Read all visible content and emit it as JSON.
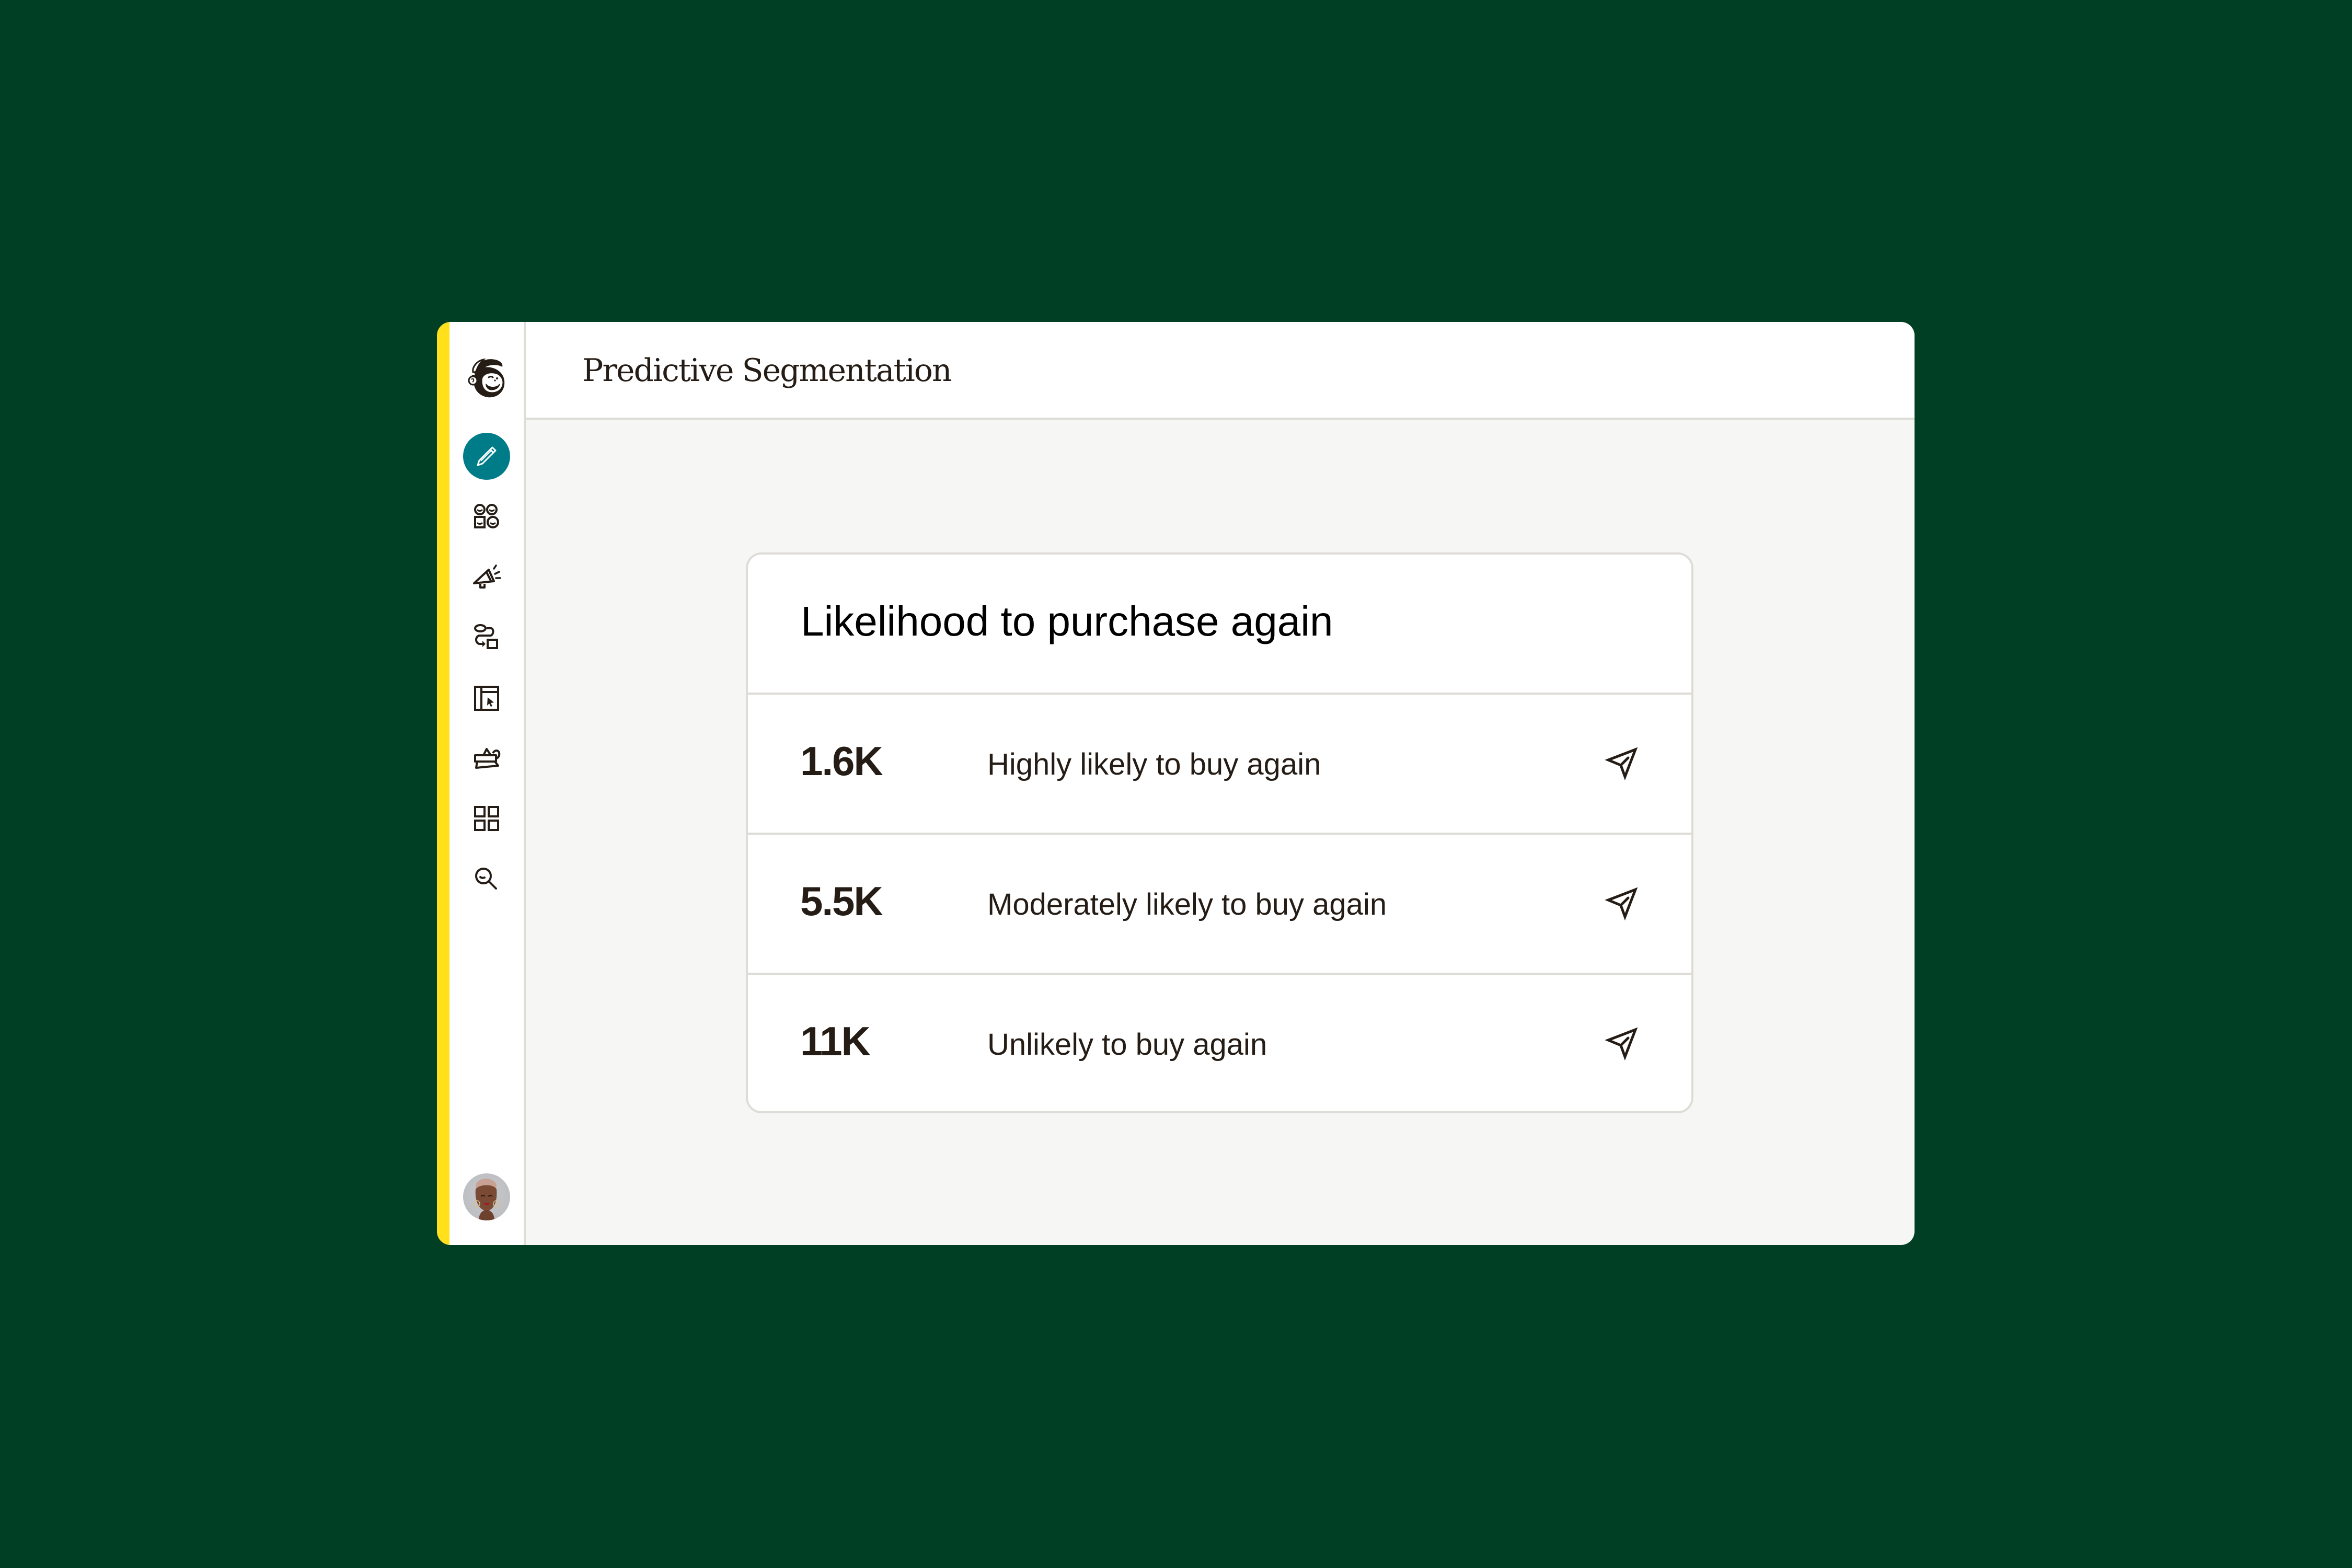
{
  "app": {
    "brand": "Mailchimp",
    "page_title": "Predictive Segmentation"
  },
  "colors": {
    "background": "#003f24",
    "accent_strip": "#ffe01b",
    "active_nav": "#007c89",
    "content_bg": "#f6f6f4",
    "border": "#dedcd6",
    "text": "#241c15"
  },
  "sidebar": {
    "logo_icon": "mailchimp-freddie-logo",
    "items": [
      {
        "id": "create",
        "icon": "pencil-icon",
        "active": true
      },
      {
        "id": "audience",
        "icon": "audience-icon",
        "active": false
      },
      {
        "id": "campaigns",
        "icon": "megaphone-icon",
        "active": false
      },
      {
        "id": "automations",
        "icon": "journey-icon",
        "active": false
      },
      {
        "id": "website",
        "icon": "website-cursor-icon",
        "active": false
      },
      {
        "id": "content",
        "icon": "shapes-icon",
        "active": false
      },
      {
        "id": "integrations",
        "icon": "grid-icon",
        "active": false
      },
      {
        "id": "search",
        "icon": "search-icon",
        "active": false
      }
    ],
    "avatar_icon": "user-avatar"
  },
  "card": {
    "title": "Likelihood to purchase again",
    "segments": [
      {
        "count": "1.6K",
        "label": "Highly likely to buy again",
        "action_icon": "send-icon"
      },
      {
        "count": "5.5K",
        "label": "Moderately likely to buy again",
        "action_icon": "send-icon"
      },
      {
        "count": "11K",
        "label": "Unlikely to buy again",
        "action_icon": "send-icon"
      }
    ]
  }
}
